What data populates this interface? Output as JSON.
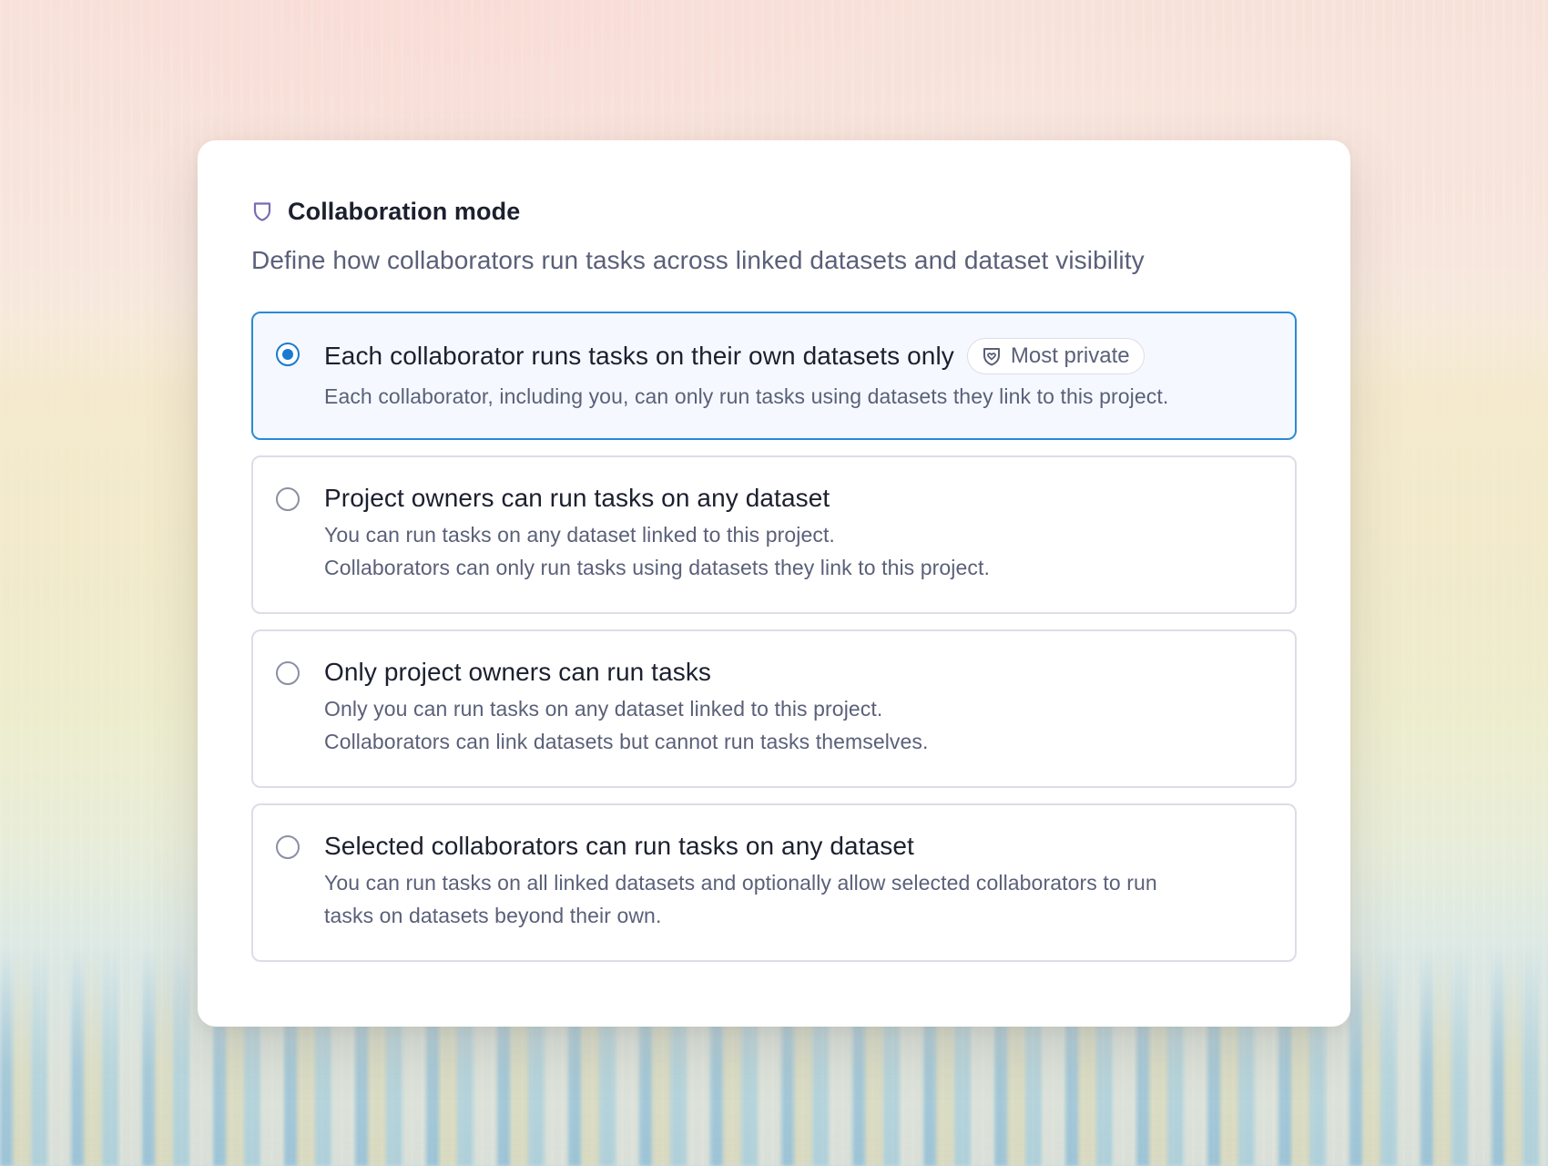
{
  "header": {
    "title": "Collaboration mode",
    "subtitle": "Define how collaborators run tasks across linked datasets and dataset visibility",
    "icon": "shield-icon"
  },
  "colors": {
    "accent": "#1b7ad0",
    "selected_border": "#2a8ad8",
    "title_text": "#1c1f2e",
    "body_text": "#5a6079",
    "icon": "#7a6bb3"
  },
  "options": [
    {
      "title": "Each collaborator runs tasks on their own datasets only",
      "badge": {
        "label": "Most private",
        "icon": "shield-heart-icon"
      },
      "description": [
        "Each collaborator, including you, can only run tasks using datasets they link to this project."
      ],
      "selected": true
    },
    {
      "title": "Project owners can run tasks on any dataset",
      "description": [
        "You can run tasks on any dataset linked to this project.",
        "Collaborators can only run tasks using datasets they link to this project."
      ],
      "selected": false
    },
    {
      "title": "Only project owners can run tasks",
      "description": [
        "Only you can run tasks on any dataset linked to this project.",
        "Collaborators can link datasets but cannot run tasks themselves."
      ],
      "selected": false
    },
    {
      "title": "Selected collaborators can run tasks on any dataset",
      "description": [
        "You can run tasks on all linked datasets and optionally allow selected collaborators to run",
        "tasks on datasets beyond their own."
      ],
      "selected": false
    }
  ]
}
